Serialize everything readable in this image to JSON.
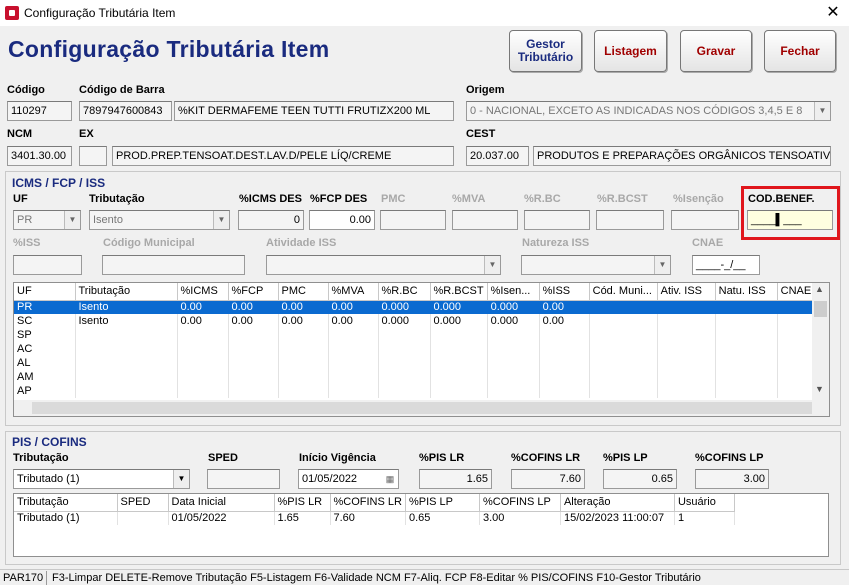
{
  "window": {
    "title": "Configuração Tributária Item",
    "close_glyph": "✕"
  },
  "header": {
    "title": "Configuração Tributária Item",
    "buttons": {
      "gestor_l1": "Gestor",
      "gestor_l2": "Tributário",
      "listagem": "Listagem",
      "gravar": "Gravar",
      "fechar": "Fechar"
    }
  },
  "item": {
    "codigo_label": "Código",
    "codigo": "110297",
    "codbarra_label": "Código de Barra",
    "codbarra": "7897947600843",
    "descricao": "%KIT DERMAFEME TEEN  TUTTI FRUTIZX200 ML",
    "origem_label": "Origem",
    "origem": "0 - NACIONAL, EXCETO AS INDICADAS NOS CÓDIGOS 3,4,5 E 8",
    "ncm_label": "NCM",
    "ncm": "3401.30.00",
    "ex_label": "EX",
    "ex": "",
    "ncm_desc": "PROD.PREP.TENSOAT.DEST.LAV.D/PELE LÍQ/CREME",
    "cest_label": "CEST",
    "cest": "20.037.00",
    "cest_desc": "PRODUTOS E PREPARAÇÕES ORGÂNICOS TENSOATIVO"
  },
  "icms": {
    "section_title": "ICMS / FCP / ISS",
    "uf_label": "UF",
    "uf": "PR",
    "trib_label": "Tributação",
    "trib": "Isento",
    "icms_des_label": "%ICMS DES",
    "icms_des": "0",
    "fcp_des_label": "%FCP DES",
    "fcp_des": "0.00",
    "pmc_label": "PMC",
    "mva_label": "%MVA",
    "rbc_label": "%R.BC",
    "rbcst_label": "%R.BCST",
    "isencao_label": "%Isenção",
    "codbenef_label": "COD.BENEF.",
    "codbenef": "____▌___",
    "iss_label": "%ISS",
    "codmun_label": "Código Municipal",
    "ativiss_label": "Atividade ISS",
    "natiss_label": "Natureza ISS",
    "cnae_label": "CNAE",
    "cnae": "____-_/__"
  },
  "icms_grid": {
    "columns": [
      "UF",
      "Tributação",
      "%ICMS",
      "%FCP",
      "PMC",
      "%MVA",
      "%R.BC",
      "%R.BCST",
      "%Isen...",
      "%ISS",
      "Cód. Muni...",
      "Ativ. ISS",
      "Natu. ISS",
      "CNAE"
    ],
    "rows": [
      [
        "PR",
        "Isento",
        "0.00",
        "0.00",
        "0.00",
        "0.00",
        "0.000",
        "0.000",
        "0.000",
        "0.00",
        "",
        "",
        "",
        ""
      ],
      [
        "SC",
        "Isento",
        "0.00",
        "0.00",
        "0.00",
        "0.00",
        "0.000",
        "0.000",
        "0.000",
        "0.00",
        "",
        "",
        "",
        ""
      ],
      [
        "SP",
        "",
        "",
        "",
        "",
        "",
        "",
        "",
        "",
        "",
        "",
        "",
        "",
        ""
      ],
      [
        "AC",
        "",
        "",
        "",
        "",
        "",
        "",
        "",
        "",
        "",
        "",
        "",
        "",
        ""
      ],
      [
        "AL",
        "",
        "",
        "",
        "",
        "",
        "",
        "",
        "",
        "",
        "",
        "",
        "",
        ""
      ],
      [
        "AM",
        "",
        "",
        "",
        "",
        "",
        "",
        "",
        "",
        "",
        "",
        "",
        "",
        ""
      ],
      [
        "AP",
        "",
        "",
        "",
        "",
        "",
        "",
        "",
        "",
        "",
        "",
        "",
        "",
        ""
      ]
    ]
  },
  "pis": {
    "section_title": "PIS / COFINS",
    "trib_label": "Tributação",
    "trib": "Tributado (1)",
    "sped_label": "SPED",
    "sped": "",
    "inicio_label": "Início Vigência",
    "inicio": "01/05/2022",
    "pislr_label": "%PIS LR",
    "pislr": "1.65",
    "cofinslr_label": "%COFINS LR",
    "cofinslr": "7.60",
    "pislp_label": "%PIS LP",
    "pislp": "0.65",
    "cofinslp_label": "%COFINS LP",
    "cofinslp": "3.00"
  },
  "pis_grid": {
    "columns": [
      "Tributação",
      "SPED",
      "Data Inicial",
      "%PIS LR",
      "%COFINS LR",
      "%PIS LP",
      "%COFINS LP",
      "Alteração",
      "Usuário"
    ],
    "rows": [
      [
        "Tributado (1)",
        "",
        "01/05/2022",
        "1.65",
        "7.60",
        "0.65",
        "3.00",
        "15/02/2023 11:00:07",
        "1"
      ]
    ]
  },
  "status": {
    "code": "PAR170",
    "shortcuts": [
      "F3-Limpar",
      "DELETE-Remove Tributação",
      "F5-Listagem",
      "F6-Validade NCM",
      "F7-Aliq. FCP",
      "F8-Editar % PIS/COFINS",
      "F10-Gestor Tributário"
    ]
  },
  "colors": {
    "title_blue": "#1a2b7f",
    "selection": "#0a6ad0",
    "highlight": "#e0161c"
  }
}
